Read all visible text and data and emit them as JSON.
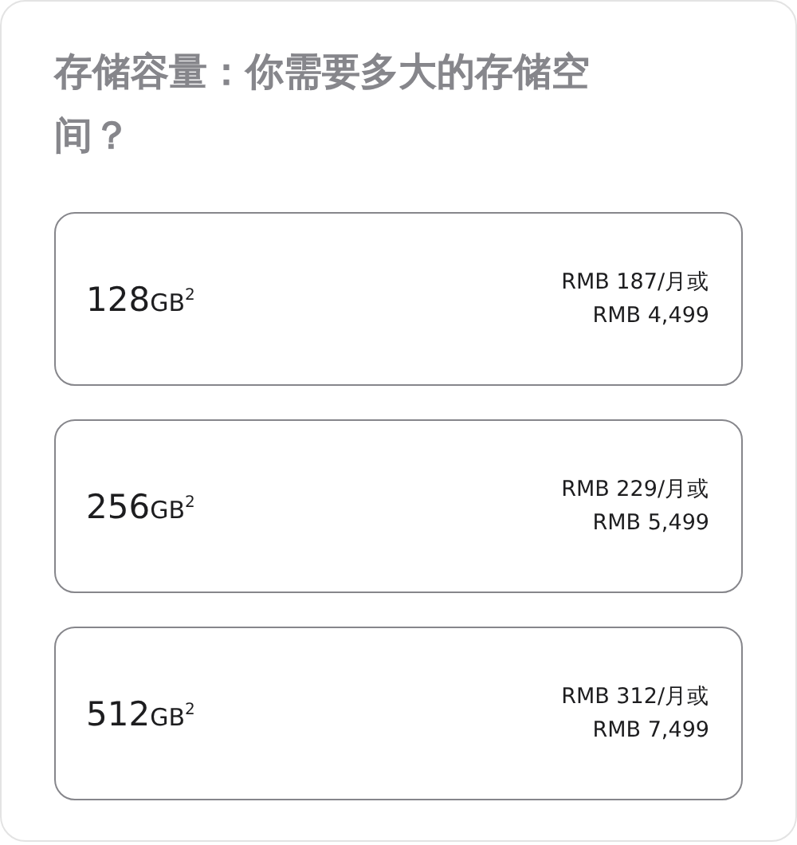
{
  "heading": "**存储容量：**你需要多大的存储空间？",
  "options": [
    {
      "size": "128",
      "unit": "GB",
      "footnote": "2",
      "monthly": "RMB 187/月或",
      "price": "RMB 4,499",
      "selected": false
    },
    {
      "size": "256",
      "unit": "GB",
      "footnote": "2",
      "monthly": "RMB 229/月或",
      "price": "RMB 5,499",
      "selected": false
    },
    {
      "size": "512",
      "unit": "GB",
      "footnote": "2",
      "monthly": "RMB 312/月或",
      "price": "RMB 7,499",
      "selected": false
    }
  ]
}
